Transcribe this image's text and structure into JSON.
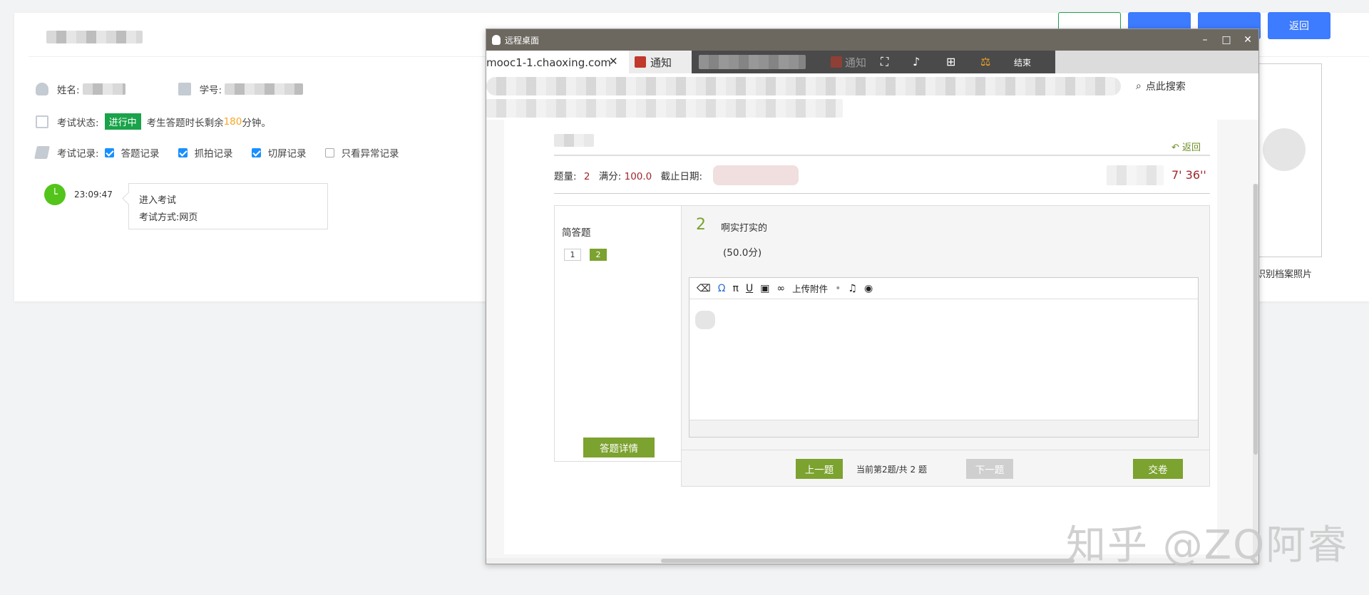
{
  "header": {
    "buttons": [
      {
        "label": ""
      },
      {
        "label": ""
      },
      {
        "label": ""
      },
      {
        "label": "返回"
      }
    ],
    "colors": {
      "primary": "#3d7bff",
      "success": "#1aa34a"
    }
  },
  "info": {
    "name_label": "姓名:",
    "student_id_label": "学号:",
    "status_label": "考试状态:",
    "status_badge": "进行中",
    "remaining_prefix": "考生答题时长剩余",
    "remaining_minutes": "180",
    "remaining_suffix": "分钟。",
    "records_label": "考试记录:",
    "record_filters": [
      {
        "label": "答题记录",
        "checked": true
      },
      {
        "label": "抓拍记录",
        "checked": true
      },
      {
        "label": "切屏记录",
        "checked": true
      },
      {
        "label": "只看异常记录",
        "checked": false
      }
    ]
  },
  "timeline": {
    "time": "23:09:47",
    "event_title": "进入考试",
    "event_method": "考试方式:网页"
  },
  "photo": {
    "label": "识别档案照片"
  },
  "remote_window": {
    "title": "远程桌面",
    "tabs": [
      {
        "label": "mooc1-1.chaoxing.com"
      },
      {
        "label": "通知"
      }
    ],
    "toolbar_tab_label": "通知",
    "toolbar_end_label": "结束",
    "search_placeholder": "点此搜索"
  },
  "exam": {
    "back_label": "返回",
    "count_label": "题量:",
    "count_value": "2",
    "full_label": "满分:",
    "full_value": "100.0",
    "deadline_label": "截止日期:",
    "timer": "7' 36''",
    "section_title": "简答题",
    "question_numbers": [
      "1",
      "2"
    ],
    "active_question": "2",
    "detail_button": "答题详情",
    "question_index": "2",
    "question_text": "啊实打实的",
    "question_score": "(50.0分)",
    "editor_upload_label": "上传附件",
    "prev_button": "上一题",
    "pager_text": "当前第2题/共 2 题",
    "next_button": "下一题",
    "submit_button": "交卷"
  },
  "watermark": "知乎 @ZQ阿睿"
}
